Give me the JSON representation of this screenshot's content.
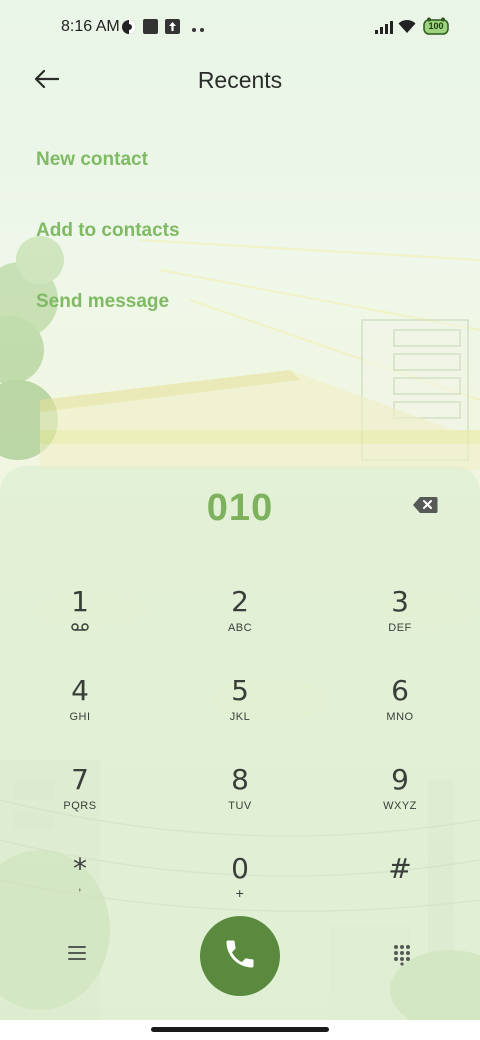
{
  "status_bar": {
    "time": "8:16 AM",
    "battery_level": "100",
    "icons": [
      "vpn-icon",
      "notification-square-icon",
      "upload-icon",
      "more-dots-icon",
      "signal-icon",
      "wifi-icon",
      "battery-icon"
    ]
  },
  "header": {
    "title": "Recents",
    "back_icon": "back-arrow-icon"
  },
  "actions": [
    {
      "label": "New contact"
    },
    {
      "label": "Add to contacts"
    },
    {
      "label": "Send message"
    }
  ],
  "dialer": {
    "number": "010",
    "backspace_icon": "backspace-icon",
    "keys": [
      {
        "digit": "1",
        "letters": "",
        "icon": "voicemail-icon"
      },
      {
        "digit": "2",
        "letters": "ABC"
      },
      {
        "digit": "3",
        "letters": "DEF"
      },
      {
        "digit": "4",
        "letters": "GHI"
      },
      {
        "digit": "5",
        "letters": "JKL"
      },
      {
        "digit": "6",
        "letters": "MNO"
      },
      {
        "digit": "7",
        "letters": "PQRS"
      },
      {
        "digit": "8",
        "letters": "TUV"
      },
      {
        "digit": "9",
        "letters": "WXYZ"
      },
      {
        "digit": "*",
        "letters": ","
      },
      {
        "digit": "0",
        "letters": "+"
      },
      {
        "digit": "#",
        "letters": ""
      }
    ],
    "menu_icon": "menu-icon",
    "call_icon": "phone-icon",
    "keypad_icon": "dialpad-icon"
  },
  "colors": {
    "accent": "#7fba64",
    "call_button": "#5a8a3e",
    "dialed_number": "#7db15e"
  }
}
